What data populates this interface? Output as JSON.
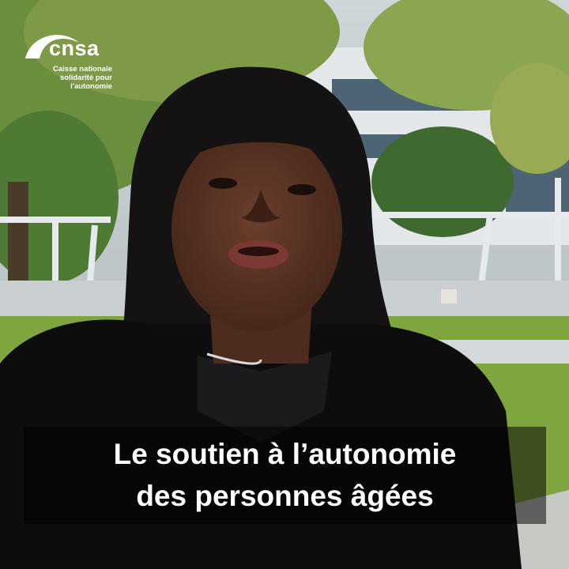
{
  "logo": {
    "name": "cnsa",
    "tagline_line1": "Caisse nationale",
    "tagline_line2": "solidarité pour l'autonomie"
  },
  "subtitle": {
    "line1": "Le soutien à l’autonomie",
    "line2": "des personnes âgées"
  },
  "colors": {
    "foliage": "#5f8a3a",
    "building": "#dfe3e6",
    "hair": "#141212",
    "skin": "#5a3426",
    "subtitle_bg": "#000000"
  }
}
